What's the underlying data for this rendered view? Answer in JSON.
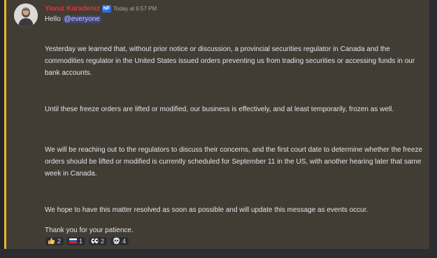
{
  "message": {
    "username": "Yavuz Karadeniz",
    "tag_badge": "NF",
    "timestamp": "Today at 6:57 PM",
    "greeting": "Hello",
    "mention": "@everyone",
    "paragraphs": [
      "Yesterday we learned that, without prior notice or discussion, a provincial securities regulator in Canada and the commodities regulator in the United States issued orders preventing us from trading securities or accessing funds in our bank accounts.",
      "Until these freeze orders are lifted or modified, our business is effectively, and at least temporarily, frozen as well.",
      "We will be reaching out to the regulators to discuss their concerns,  and the first court date to determine whether the freeze orders should be lifted or modified is currently scheduled for September 11 in the US, with another hearing later that same week in Canada.",
      "We hope to have this matter resolved as soon as possible and will update this message as events occur.",
      "Thank you for your patience."
    ]
  },
  "reactions": [
    {
      "icon": "thumbs-up-icon",
      "count": "2"
    },
    {
      "icon": "russia-flag-icon",
      "count": "1"
    },
    {
      "icon": "eyes-icon",
      "count": "2"
    },
    {
      "icon": "skull-icon",
      "count": "4"
    }
  ],
  "colors": {
    "username": "#ed2d36",
    "highlight_bar": "#f0b232",
    "message_bg": "#413d35",
    "mention_bg": "#3f4473",
    "text": "#e3e5e8"
  }
}
